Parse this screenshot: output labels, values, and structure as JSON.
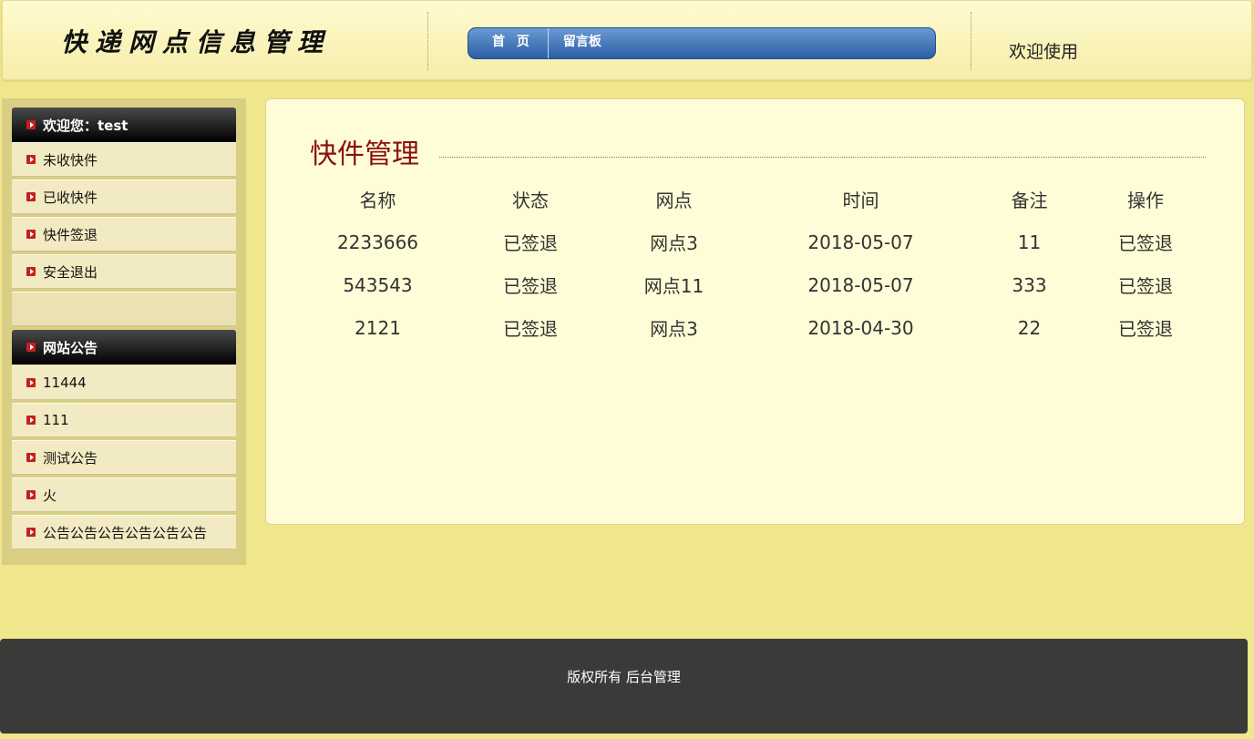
{
  "header": {
    "logo_text": "快递网点信息管理",
    "nav": [
      "首 页",
      "留言板"
    ],
    "welcome": "欢迎使用"
  },
  "sidebar": {
    "user_heading": "欢迎您：test",
    "menu": [
      "未收快件",
      "已收快件",
      "快件签退",
      "安全退出"
    ],
    "notice_heading": "网站公告",
    "notices": [
      "11444",
      "111",
      "测试公告",
      "火",
      "公告公告公告公告公告公告"
    ]
  },
  "main": {
    "title": "快件管理",
    "columns": [
      "名称",
      "状态",
      "网点",
      "时间",
      "备注",
      "操作"
    ],
    "rows": [
      [
        "2233666",
        "已签退",
        "网点3",
        "2018-05-07",
        "11",
        "已签退"
      ],
      [
        "543543",
        "已签退",
        "网点11",
        "2018-05-07",
        "333",
        "已签退"
      ],
      [
        "2121",
        "已签退",
        "网点3",
        "2018-04-30",
        "22",
        "已签退"
      ]
    ]
  },
  "footer": {
    "text": "版权所有 后台管理"
  },
  "colors": {
    "page_background": "#f0e68c",
    "title_color": "#8b0f0f",
    "nav_blue": "#2a5fa5",
    "footer_background": "#3a3a38"
  },
  "icons": {
    "sidebar_bullet": "red-arrow-bullet-icon"
  }
}
